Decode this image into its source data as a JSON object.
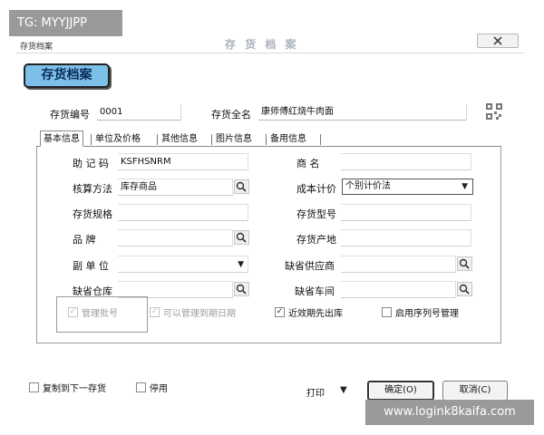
{
  "overlay": {
    "tag_label": "TG: MYYJJPP",
    "site_watermark": "www.logink8kaifa.com"
  },
  "window": {
    "title": "存货档案",
    "center_title": "存 货 档 案",
    "close_icon": "close-icon"
  },
  "form": {
    "title": "存货档案",
    "code_label": "存货编号",
    "code_value": "0001",
    "fullname_label": "存货全名",
    "fullname_value": "康师傅红烧牛肉面",
    "qr_icon": "qr-code-icon"
  },
  "tabs": [
    "基本信息",
    "单位及价格",
    "其他信息",
    "图片信息",
    "备用信息"
  ],
  "active_tab": 0,
  "fields": {
    "mnemonic_label": "助 记 码",
    "mnemonic_value": "KSFHSNRM",
    "brand_label": "商    名",
    "brand_value": "",
    "accounting_label": "核算方法",
    "accounting_value": "库存商品",
    "costing_label": "成本计价",
    "costing_value": "个别计价法",
    "spec_label": "存货规格",
    "spec_value": "",
    "model_label": "存货型号",
    "model_value": "",
    "category_label": "品    牌",
    "category_value": "",
    "origin_label": "存货产地",
    "origin_value": "",
    "sub_unit_label": "副 单 位",
    "sub_unit_value": "",
    "supplier_label": "缺省供应商",
    "supplier_value": "",
    "warehouse_label": "缺省仓库",
    "warehouse_value": "",
    "workshop_label": "缺省车间",
    "workshop_value": ""
  },
  "options": {
    "batch_label": "管理批号",
    "expiry_label": "可以管理到期日期",
    "fifo_label": "近效期先出库",
    "serial_label": "启用序列号管理"
  },
  "footer": {
    "copy_next_label": "复制到下一存货",
    "disable_label": "停用",
    "print_label": "打印",
    "ok_label": "确定(O)",
    "cancel_label": "取消(C)"
  }
}
